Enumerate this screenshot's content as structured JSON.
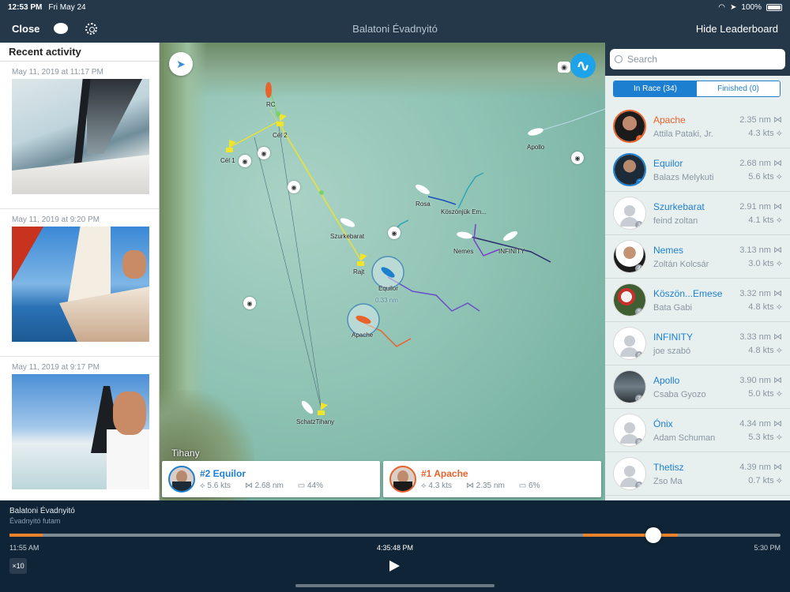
{
  "status": {
    "time": "12:53 PM",
    "date": "Fri May 24",
    "battery": "100%"
  },
  "nav": {
    "close": "Close",
    "title": "Balatoni Évadnyitó",
    "hide_leaderboard": "Hide Leaderboard"
  },
  "activity": {
    "heading": "Recent activity",
    "items": [
      {
        "timestamp": "May 11, 2019 at 11:17 PM"
      },
      {
        "timestamp": "May 11, 2019 at 9:20 PM"
      },
      {
        "timestamp": "May 11, 2019 at 9:17 PM"
      }
    ]
  },
  "map": {
    "place": "Tihany",
    "distance_label": "0.33 nm",
    "boat_labels": {
      "rc": "RC",
      "cel1": "Cél 1",
      "cel2": "Cél 2",
      "apollo": "Apollo",
      "rosa": "Rosa",
      "koszonjuk": "Köszönjük Em...",
      "nemes": "Nemes",
      "infinity": "INFINITY",
      "szurkebarat": "Szurkebarat",
      "rajt": "Rajt",
      "equilor": "Equilor",
      "apache": "Apache",
      "schatihany": "SchatzTihany"
    },
    "colors": {
      "course": "#e8e23a",
      "equilor_track": "#6a4fc8",
      "apache_track": "#e8632b"
    }
  },
  "cards": [
    {
      "rank_name": "#2  Equilor",
      "speed": "5.6 kts",
      "dist": "2.68 nm",
      "battery": "44%"
    },
    {
      "rank_name": "#1  Apache",
      "speed": "4.3 kts",
      "dist": "2.35 nm",
      "battery": "6%"
    }
  ],
  "leaderboard": {
    "search_placeholder": "Search",
    "tabs": {
      "in_race": "In Race (34)",
      "finished": "Finished (0)"
    },
    "rows": [
      {
        "rank": "1",
        "boat": "Apache",
        "skipper": "Attila Pataki, Jr.",
        "dist": "2.35 nm",
        "speed": "4.3 kts"
      },
      {
        "rank": "2",
        "boat": "Equilor",
        "skipper": "Balazs Melykuti",
        "dist": "2.68 nm",
        "speed": "5.6 kts"
      },
      {
        "rank": "3",
        "boat": "Szurkebarat",
        "skipper": "feind zoltan",
        "dist": "2.91 nm",
        "speed": "4.1 kts"
      },
      {
        "rank": "4",
        "boat": "Nemes",
        "skipper": "Zoltán  Kolcsár",
        "dist": "3.13 nm",
        "speed": "3.0 kts"
      },
      {
        "rank": "5",
        "boat": "Köszön...Emese",
        "skipper": "Bata Gabi",
        "dist": "3.32 nm",
        "speed": "4.8 kts"
      },
      {
        "rank": "6",
        "boat": "INFINITY",
        "skipper": "joe szabó",
        "dist": "3.33 nm",
        "speed": "4.8 kts"
      },
      {
        "rank": "7",
        "boat": "Apollo",
        "skipper": "Csaba Gyozo",
        "dist": "3.90 nm",
        "speed": "5.0 kts"
      },
      {
        "rank": "8",
        "boat": "Ónix",
        "skipper": "Adam Schuman",
        "dist": "4.34 nm",
        "speed": "5.3 kts"
      },
      {
        "rank": "9",
        "boat": "Thetisz",
        "skipper": "Zso Ma",
        "dist": "4.39 nm",
        "speed": "0.7 kts"
      }
    ]
  },
  "playback": {
    "race": "Balatoni Évadnyitó",
    "sub": "Évadnyitó futam",
    "start": "11:55 AM",
    "current": "4:35:48 PM",
    "end": "5:30 PM",
    "speed": "×10",
    "progress_fraction": 0.835
  }
}
